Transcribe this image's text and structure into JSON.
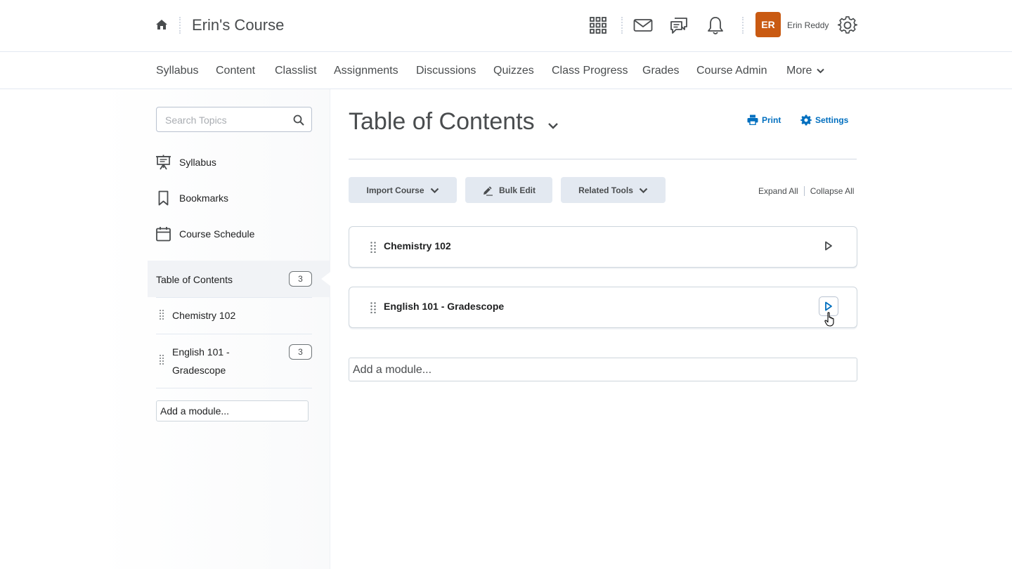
{
  "header": {
    "course_title": "Erin's Course",
    "avatar_initials": "ER",
    "avatar_color": "#c95a12",
    "user_name": "Erin Reddy",
    "icons": [
      "home-icon",
      "waffle-icon",
      "mail-icon",
      "chat-icon",
      "bell-icon",
      "gear-icon"
    ]
  },
  "nav": {
    "items": [
      "Syllabus",
      "Content",
      "Classlist",
      "Assignments",
      "Discussions",
      "Quizzes",
      "Class Progress",
      "Grades",
      "Course Admin"
    ],
    "more_label": "More"
  },
  "sidebar": {
    "search_placeholder": "Search Topics",
    "links": [
      {
        "label": "Syllabus",
        "icon": "presentation-icon"
      },
      {
        "label": "Bookmarks",
        "icon": "bookmark-icon"
      },
      {
        "label": "Course Schedule",
        "icon": "calendar-icon"
      }
    ],
    "toc": {
      "label": "Table of Contents",
      "count": "3"
    },
    "modules": [
      {
        "label": "Chemistry 102"
      },
      {
        "label": "English 101 - Gradescope",
        "count": "3"
      }
    ],
    "add_module": "Add a module..."
  },
  "main": {
    "title": "Table of Contents",
    "print_label": "Print",
    "settings_label": "Settings",
    "buttons": {
      "import_course": "Import Course",
      "bulk_edit": "Bulk Edit",
      "related_tools": "Related Tools"
    },
    "expand_all": "Expand All",
    "collapse_all": "Collapse All",
    "modules": [
      {
        "name": "Chemistry 102"
      },
      {
        "name": "English 101 - Gradescope"
      }
    ],
    "add_module": "Add a module...",
    "accent_color": "#006fbf"
  }
}
